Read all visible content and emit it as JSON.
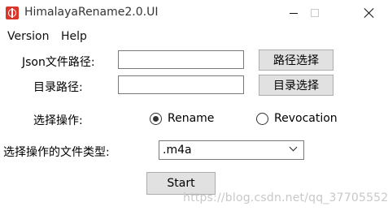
{
  "window": {
    "title": "HimalayaRename2.0.UI"
  },
  "menu": {
    "items": [
      "Version",
      "Help"
    ]
  },
  "form": {
    "json_path_label": "Json文件路径:",
    "json_path_value": "",
    "json_browse_button": "路径选择",
    "dir_path_label": "目录路径:",
    "dir_path_value": "",
    "dir_browse_button": "目录选择",
    "operation_label": "选择操作:",
    "operations": [
      {
        "label": "Rename",
        "selected": true
      },
      {
        "label": "Revocation",
        "selected": false
      }
    ],
    "file_type_label": "选择操作的文件类型:",
    "file_type_selected": ".m4a",
    "start_button": "Start"
  },
  "watermark": {
    "text": "https://blog.csdn.net/qq_37705552"
  },
  "colors": {
    "app_icon": "#d9362b",
    "button_bg": "#e1e1e1",
    "button_border": "#adadad",
    "input_border": "#7a7a7a"
  }
}
